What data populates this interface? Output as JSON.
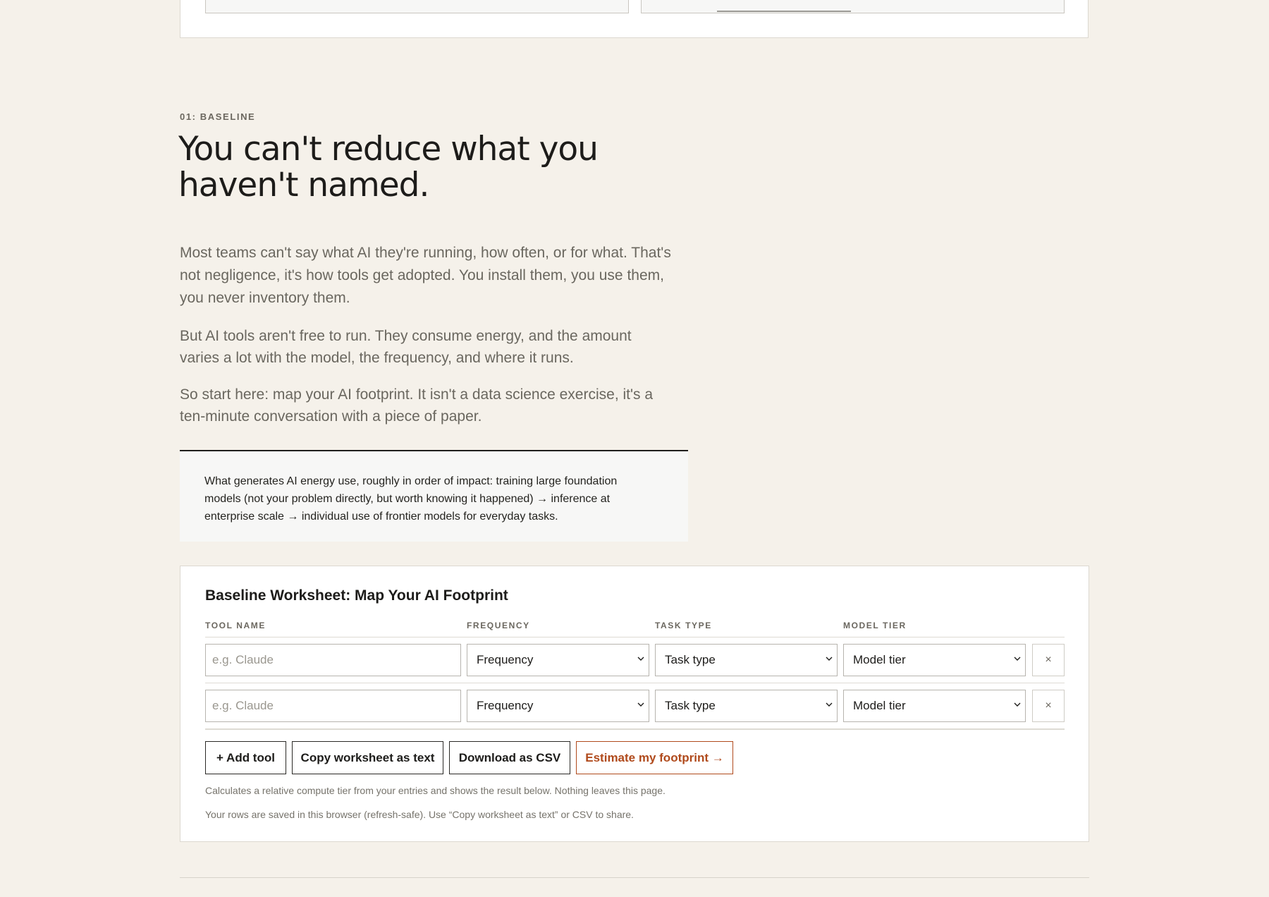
{
  "section": {
    "eyebrow": "01: BASELINE",
    "headline_line1": "You can't reduce what you",
    "headline_line2": "haven't named.",
    "paragraphs": [
      "Most teams can't say what AI they're running, how often, or for what. That's not negligence, it's how tools get adopted. You install them, you use them, you never inventory them.",
      "But AI tools aren't free to run. They consume energy, and the amount varies a lot with the model, the frequency, and where it runs.",
      "So start here: map your AI footprint. It isn't a data science exercise, it's a ten-minute conversation with a piece of paper."
    ],
    "callout": "What generates AI energy use, roughly in order of impact: training large foundation models (not your problem directly, but worth knowing it happened) → inference at enterprise scale → individual use of frontier models for everyday tasks."
  },
  "worksheet": {
    "title": "Baseline Worksheet: Map Your AI Footprint",
    "columns": [
      "TOOL NAME",
      "FREQUENCY",
      "TASK TYPE",
      "MODEL TIER"
    ],
    "rows": [
      {
        "tool_placeholder": "e.g. Claude",
        "frequency": "Frequency",
        "task_type": "Task type",
        "model_tier": "Model tier",
        "remove": "×"
      },
      {
        "tool_placeholder": "e.g. Claude",
        "frequency": "Frequency",
        "task_type": "Task type",
        "model_tier": "Model tier",
        "remove": "×"
      }
    ],
    "buttons": {
      "add_tool": "+ Add tool",
      "copy_text": "Copy worksheet as text",
      "download_csv": "Download as CSV",
      "estimate": "Estimate my footprint →"
    },
    "note1": "Calculates a relative compute tier from your entries and shows the result below. Nothing leaves this page.",
    "note2": "Your rows are saved in this browser (refresh-safe). Use “Copy worksheet as text” or CSV to share."
  },
  "colors": {
    "background": "#f5f1ea",
    "accent": "#b04a1c"
  },
  "icons": {
    "select_arrow": "chevron-down-icon",
    "remove": "close-icon"
  }
}
